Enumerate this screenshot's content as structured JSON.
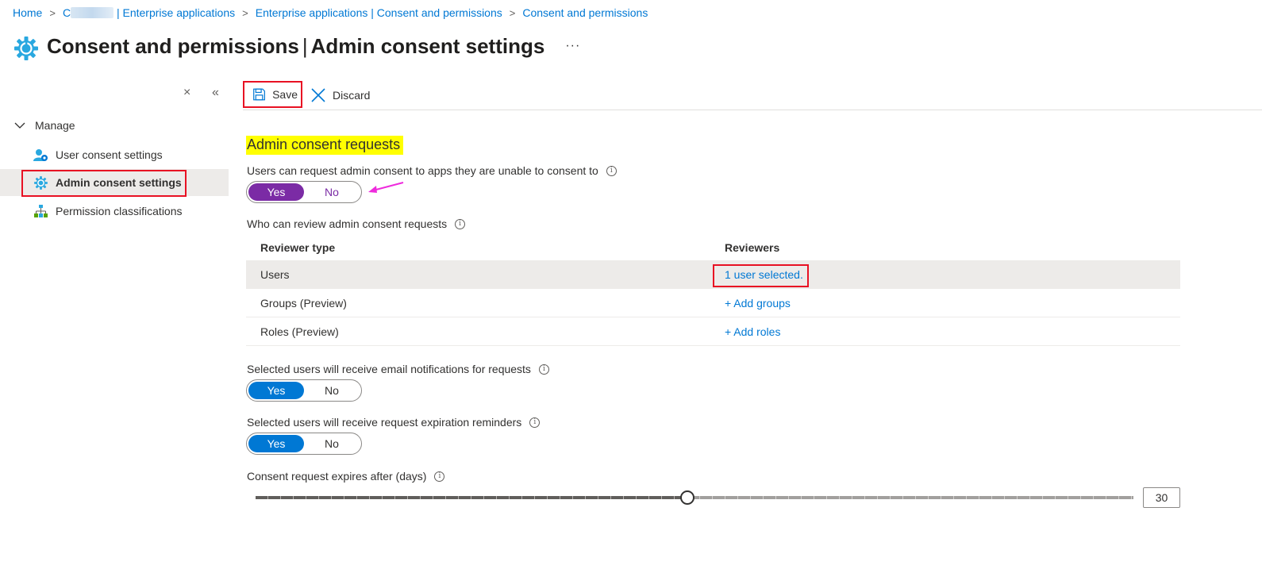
{
  "breadcrumb": {
    "items": [
      "Home",
      "C",
      "| Enterprise applications",
      "Enterprise applications | Consent and permissions",
      "Consent and permissions"
    ]
  },
  "header": {
    "title_bold": "Consent and permissions",
    "separator": "|",
    "title_rest": "Admin consent settings",
    "more": "···"
  },
  "sidebar": {
    "close": "×",
    "collapse": "«",
    "group_label": "Manage",
    "items": [
      {
        "label": "User consent settings",
        "icon": "user-settings-icon"
      },
      {
        "label": "Admin consent settings",
        "icon": "gear-icon"
      },
      {
        "label": "Permission classifications",
        "icon": "hierarchy-icon"
      }
    ]
  },
  "toolbar": {
    "save_label": "Save",
    "discard_label": "Discard"
  },
  "main": {
    "section_title": "Admin consent requests",
    "request_consent": {
      "label": "Users can request admin consent to apps they are unable to consent to",
      "yes": "Yes",
      "no": "No",
      "selected": "Yes"
    },
    "reviewers": {
      "label": "Who can review admin consent requests",
      "columns": [
        "Reviewer type",
        "Reviewers"
      ],
      "rows": [
        {
          "type": "Users",
          "value": "1 user selected."
        },
        {
          "type": "Groups (Preview)",
          "value": "+ Add groups"
        },
        {
          "type": "Roles (Preview)",
          "value": "+ Add roles"
        }
      ]
    },
    "email_notifications": {
      "label": "Selected users will receive email notifications for requests",
      "yes": "Yes",
      "no": "No",
      "selected": "Yes"
    },
    "expiration_reminders": {
      "label": "Selected users will receive request expiration reminders",
      "yes": "Yes",
      "no": "No",
      "selected": "Yes"
    },
    "expiry": {
      "label": "Consent request expires after (days)",
      "value": "30",
      "slider_min": 1,
      "slider_max": 60,
      "slider_value": 30
    }
  },
  "colors": {
    "link": "#0078d4",
    "toggle_on": "#0078d4",
    "toggle_on_highlighted": "#7b2ba5",
    "highlight": "#ffff00",
    "annotation_box": "#e81123",
    "annotation_arrow": "#ee2bdc"
  }
}
